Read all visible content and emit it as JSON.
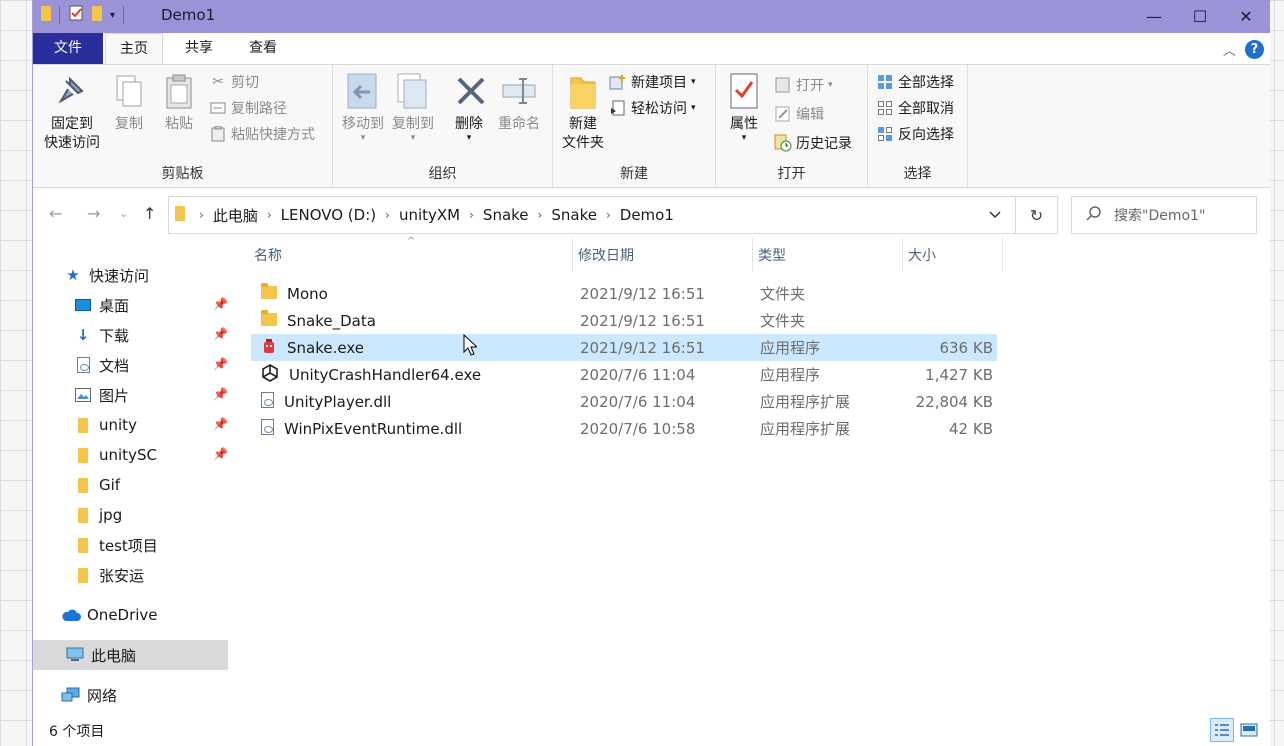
{
  "window": {
    "title": "Demo1",
    "controls": {
      "minimize": "—",
      "maximize": "☐",
      "close": "✕"
    }
  },
  "tabs": [
    {
      "label": "文件"
    },
    {
      "label": "主页"
    },
    {
      "label": "共享"
    },
    {
      "label": "查看"
    }
  ],
  "ribbon": {
    "clipboard": {
      "pin_label_1": "固定到",
      "pin_label_2": "快速访问",
      "copy_label": "复制",
      "paste_label": "粘贴",
      "cut_label": "剪切",
      "copy_path_label": "复制路径",
      "paste_shortcut_label": "粘贴快捷方式",
      "group_label": "剪贴板"
    },
    "organize": {
      "move_label": "移动到",
      "copy_to_label": "复制到",
      "delete_label": "删除",
      "rename_label": "重命名",
      "group_label": "组织"
    },
    "new": {
      "new_folder_label_1": "新建",
      "new_folder_label_2": "文件夹",
      "new_item_label": "新建项目",
      "easy_access_label": "轻松访问",
      "group_label": "新建"
    },
    "open": {
      "properties_label": "属性",
      "open_label": "打开",
      "edit_label": "编辑",
      "history_label": "历史记录",
      "group_label": "打开"
    },
    "select": {
      "select_all_label": "全部选择",
      "select_none_label": "全部取消",
      "invert_label": "反向选择",
      "group_label": "选择"
    }
  },
  "address": {
    "crumbs": [
      "此电脑",
      "LENOVO (D:)",
      "unityXM",
      "Snake",
      "Snake",
      "Demo1"
    ],
    "search_placeholder": "搜索\"Demo1\""
  },
  "sidebar": {
    "quick_access_label": "快速访问",
    "items": [
      {
        "label": "桌面",
        "pinned": true
      },
      {
        "label": "下载",
        "pinned": true
      },
      {
        "label": "文档",
        "pinned": true
      },
      {
        "label": "图片",
        "pinned": true
      },
      {
        "label": "unity",
        "pinned": true
      },
      {
        "label": "unitySC",
        "pinned": true
      },
      {
        "label": "Gif",
        "pinned": false
      },
      {
        "label": "jpg",
        "pinned": false
      },
      {
        "label": "test项目",
        "pinned": false
      },
      {
        "label": "张安运",
        "pinned": false
      }
    ],
    "onedrive_label": "OneDrive",
    "this_pc_label": "此电脑",
    "network_label": "网络"
  },
  "columns": {
    "name": "名称",
    "date": "修改日期",
    "type": "类型",
    "size": "大小"
  },
  "files": [
    {
      "name": "Mono",
      "date": "2021/9/12 16:51",
      "type": "文件夹",
      "size": "",
      "icon": "folder-icon"
    },
    {
      "name": "Snake_Data",
      "date": "2021/9/12 16:51",
      "type": "文件夹",
      "size": "",
      "icon": "folder-icon"
    },
    {
      "name": "Snake.exe",
      "date": "2021/9/12 16:51",
      "type": "应用程序",
      "size": "636 KB",
      "icon": "snake-app-icon"
    },
    {
      "name": "UnityCrashHandler64.exe",
      "date": "2020/7/6 11:04",
      "type": "应用程序",
      "size": "1,427 KB",
      "icon": "unity-icon"
    },
    {
      "name": "UnityPlayer.dll",
      "date": "2020/7/6 11:04",
      "type": "应用程序扩展",
      "size": "22,804 KB",
      "icon": "dll-icon"
    },
    {
      "name": "WinPixEventRuntime.dll",
      "date": "2020/7/6 10:58",
      "type": "应用程序扩展",
      "size": "42 KB",
      "icon": "dll-icon"
    }
  ],
  "status": {
    "item_count": "6 个项目"
  },
  "colors": {
    "titlebar": "#9b93d8",
    "file_tab": "#2a2d9c",
    "selected_row": "#cce8ff",
    "accent": "#1e6fd0"
  }
}
